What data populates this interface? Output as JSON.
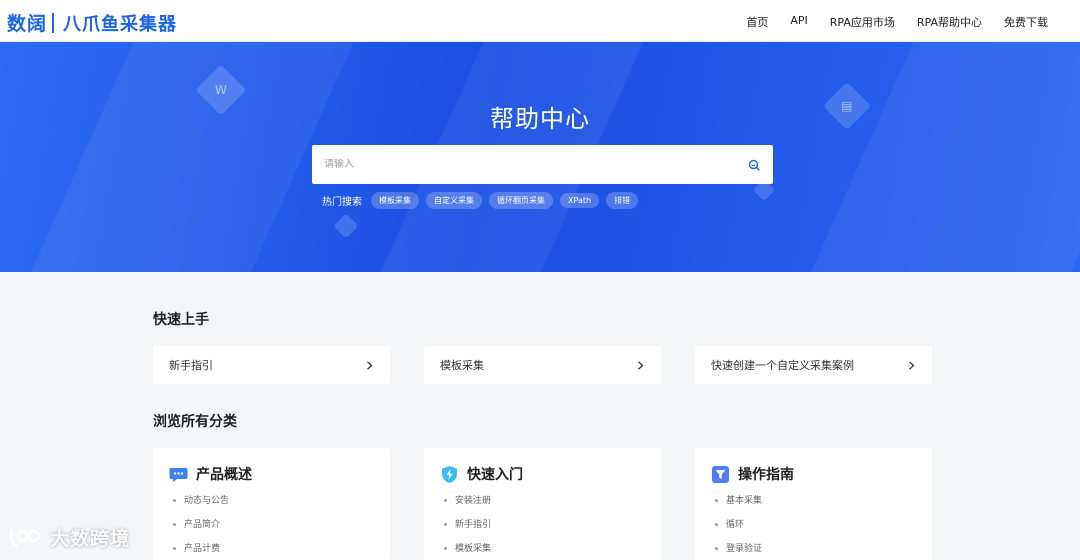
{
  "brand": {
    "logo_text": "数阔",
    "product_name": "八爪鱼采集器"
  },
  "nav": {
    "items": [
      "首页",
      "API",
      "RPA应用市场",
      "RPA帮助中心",
      "免费下载"
    ]
  },
  "hero": {
    "title": "帮助中心",
    "search_placeholder": "请输入",
    "hot_label": "热门搜索",
    "hot_tags": [
      "模板采集",
      "自定义采集",
      "循环翻页采集",
      "XPath",
      "排错"
    ]
  },
  "quick_start": {
    "title": "快速上手",
    "items": [
      "新手指引",
      "模板采集",
      "快速创建一个自定义采集案例"
    ]
  },
  "categories": {
    "title": "浏览所有分类",
    "items": [
      {
        "title": "产品概述",
        "icon": "chat-bubble-icon",
        "links": [
          "动态与公告",
          "产品简介",
          "产品计费"
        ]
      },
      {
        "title": "快速入门",
        "icon": "lightning-shield-icon",
        "links": [
          "安装注册",
          "新手指引",
          "模板采集"
        ]
      },
      {
        "title": "操作指南",
        "icon": "funnel-icon",
        "links": [
          "基本采集",
          "循环",
          "登录验证"
        ]
      }
    ]
  },
  "watermark": {
    "text": "大数跨境"
  },
  "colors": {
    "brand_blue": "#1d64e8",
    "hero_blue": "#1a4fe3",
    "page_bg": "#f5f6f8"
  }
}
